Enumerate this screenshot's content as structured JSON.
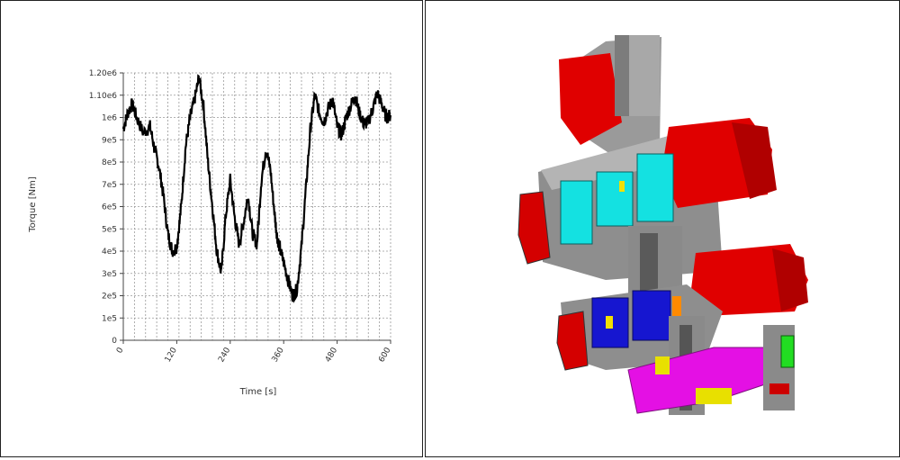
{
  "chart_data": {
    "type": "line",
    "xlabel": "Time [s]",
    "ylabel": "Torque [Nm]",
    "xlim": [
      0,
      600
    ],
    "ylim": [
      0,
      1200000
    ],
    "x_ticks": [
      0,
      120,
      240,
      360,
      480,
      600
    ],
    "x_tick_labels": [
      "0",
      "120",
      "240",
      "360",
      "480",
      "600"
    ],
    "y_tick_labels": [
      "0",
      "1e5",
      "2e5",
      "3e5",
      "4e5",
      "5e5",
      "6e5",
      "7e5",
      "8e5",
      "9e5",
      "1e6",
      "1.10e6",
      "1.20e6"
    ],
    "grid": true,
    "series": [
      {
        "color": "#000000",
        "x": [
          0,
          10,
          20,
          30,
          45,
          60,
          70,
          80,
          90,
          100,
          110,
          120,
          130,
          140,
          150,
          160,
          170,
          180,
          190,
          200,
          210,
          220,
          230,
          240,
          250,
          260,
          270,
          280,
          290,
          300,
          310,
          320,
          330,
          340,
          345,
          350,
          360,
          370,
          380,
          390,
          400,
          410,
          420,
          430,
          440,
          450,
          460,
          470,
          480,
          490,
          500,
          510,
          520,
          530,
          540,
          550,
          560,
          570,
          580,
          590,
          600
        ],
        "y": [
          950000,
          1020000,
          1060000,
          1000000,
          930000,
          960000,
          860000,
          780000,
          650000,
          480000,
          400000,
          420000,
          600000,
          870000,
          1000000,
          1080000,
          1180000,
          1050000,
          800000,
          600000,
          400000,
          300000,
          560000,
          720000,
          550000,
          430000,
          530000,
          650000,
          480000,
          430000,
          720000,
          860000,
          770000,
          560000,
          470000,
          420000,
          350000,
          270000,
          200000,
          230000,
          420000,
          680000,
          950000,
          1100000,
          1020000,
          980000,
          1040000,
          1080000,
          960000,
          920000,
          1000000,
          1050000,
          1100000,
          1020000,
          970000,
          980000,
          1040000,
          1110000,
          1060000,
          1000000,
          1010000
        ]
      }
    ]
  }
}
